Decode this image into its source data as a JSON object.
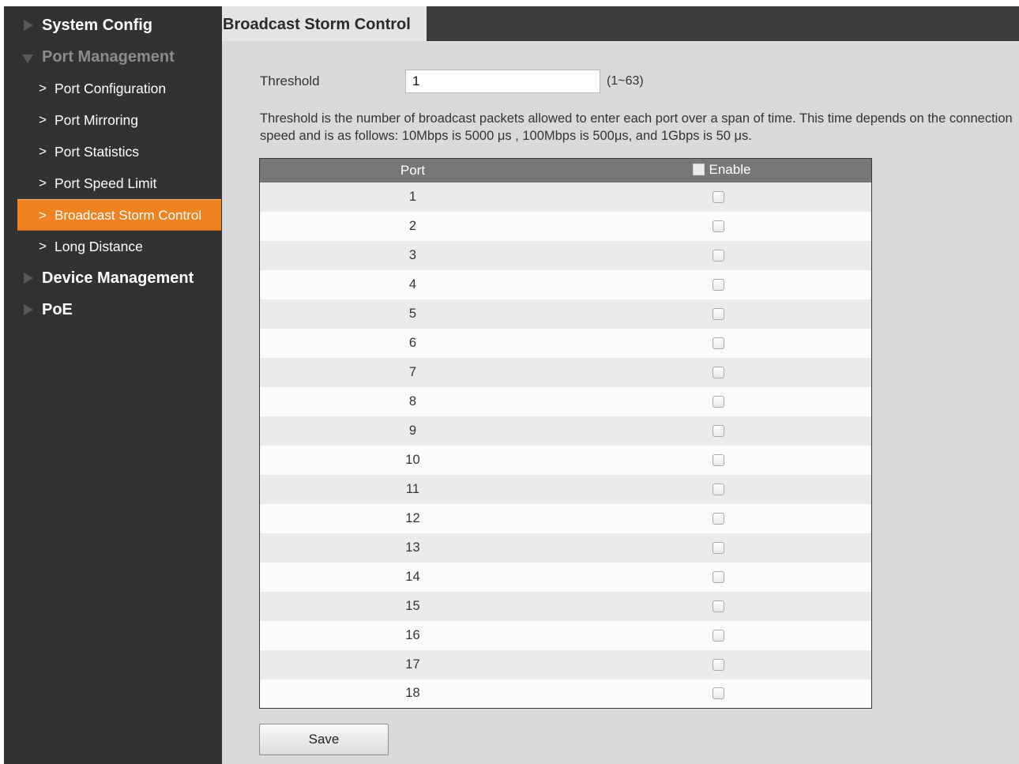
{
  "sidebar": {
    "groups": [
      {
        "label": "System Config",
        "expanded": false
      },
      {
        "label": "Port Management",
        "expanded": true,
        "items": [
          "Port Configuration",
          "Port Mirroring",
          "Port Statistics",
          "Port Speed Limit",
          "Broadcast Storm Control",
          "Long Distance"
        ],
        "active_item": "Broadcast Storm Control"
      },
      {
        "label": "Device Management",
        "expanded": false
      },
      {
        "label": "PoE",
        "expanded": false
      }
    ]
  },
  "page": {
    "title": "Broadcast Storm Control",
    "threshold": {
      "label": "Threshold",
      "value": "1",
      "range": "(1~63)"
    },
    "description": "Threshold is the number of broadcast packets allowed to enter each port over a span of time. This time depends on the connection speed and is as follows: 10Mbps is 5000 μs , 100Mbps is 500μs, and 1Gbps is 50 μs.",
    "table": {
      "headers": {
        "port": "Port",
        "enable": "Enable"
      },
      "select_all_checked": false,
      "rows": [
        {
          "port": "1",
          "enabled": false
        },
        {
          "port": "2",
          "enabled": false
        },
        {
          "port": "3",
          "enabled": false
        },
        {
          "port": "4",
          "enabled": false
        },
        {
          "port": "5",
          "enabled": false
        },
        {
          "port": "6",
          "enabled": false
        },
        {
          "port": "7",
          "enabled": false
        },
        {
          "port": "8",
          "enabled": false
        },
        {
          "port": "9",
          "enabled": false
        },
        {
          "port": "10",
          "enabled": false
        },
        {
          "port": "11",
          "enabled": false
        },
        {
          "port": "12",
          "enabled": false
        },
        {
          "port": "13",
          "enabled": false
        },
        {
          "port": "14",
          "enabled": false
        },
        {
          "port": "15",
          "enabled": false
        },
        {
          "port": "16",
          "enabled": false
        },
        {
          "port": "17",
          "enabled": false
        },
        {
          "port": "18",
          "enabled": false
        }
      ]
    },
    "save_label": "Save"
  },
  "colors": {
    "sidebar_bg": "#323232",
    "active_item": "#f08321",
    "content_bg": "#dadada",
    "table_header": "#777777"
  }
}
